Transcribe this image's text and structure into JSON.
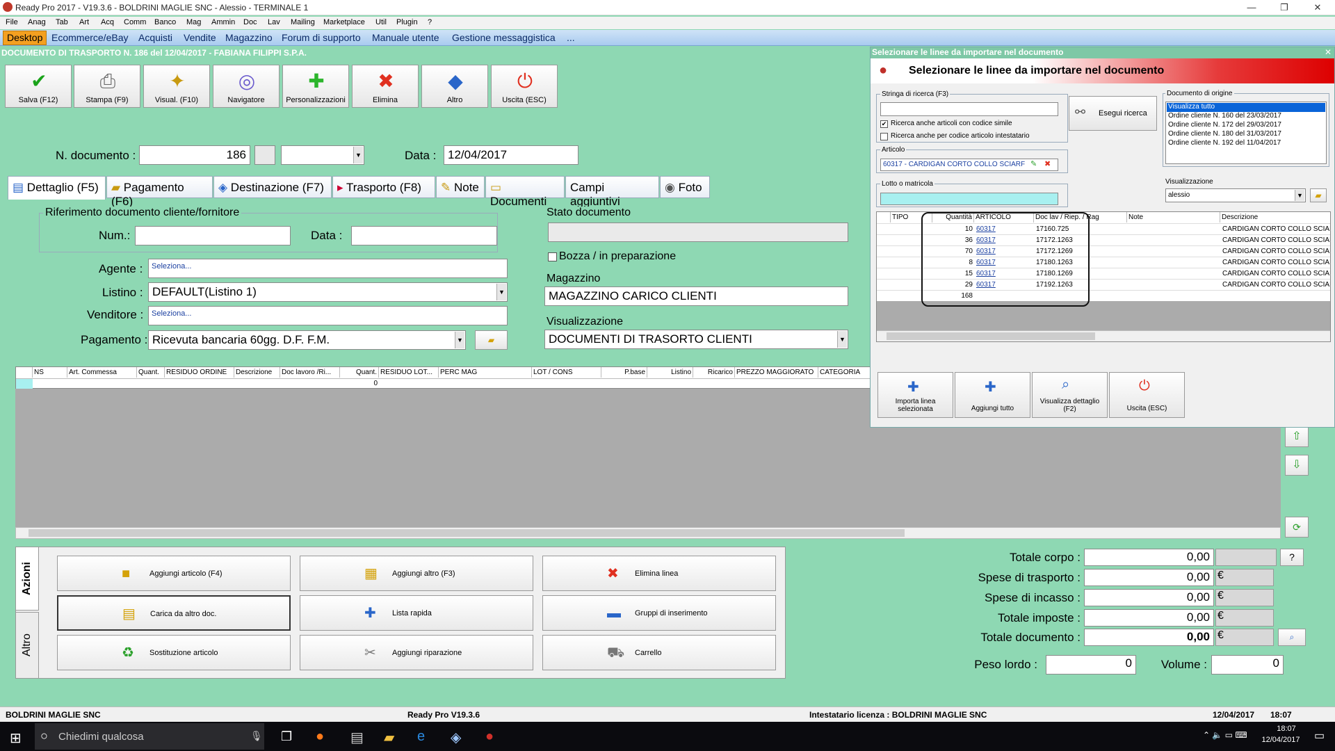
{
  "window": {
    "title": "Ready Pro 2017 - V19.3.6 - BOLDRINI MAGLIE SNC - Alessio - TERMINALE 1"
  },
  "menu": [
    "File",
    "Anag",
    "Tab",
    "Art",
    "Acq",
    "Comm",
    "Banco",
    "Mag",
    "Ammin",
    "Doc",
    "Lav",
    "Mailing",
    "Marketplace",
    "Util",
    "Plugin",
    "?"
  ],
  "tabs": [
    "Desktop",
    "Ecommerce/eBay",
    "Acquisti",
    "Vendite",
    "Magazzino",
    "Forum di supporto",
    "Manuale utente",
    "Gestione messaggistica",
    "..."
  ],
  "doc_title": "DOCUMENTO DI TRASPORTO N. 186 del 12/04/2017 - FABIANA FILIPPI S.P.A.",
  "toolbar": [
    {
      "label": "Salva (F12)",
      "icon": "check-icon"
    },
    {
      "label": "Stampa (F9)",
      "icon": "printer-icon"
    },
    {
      "label": "Visual. (F10)",
      "icon": "magic-wand-icon"
    },
    {
      "label": "Navigatore",
      "icon": "navigator-icon"
    },
    {
      "label": "Personalizzazioni",
      "icon": "puzzle-icon"
    },
    {
      "label": "Elimina",
      "icon": "delete-icon"
    },
    {
      "label": "Altro",
      "icon": "altro-icon"
    },
    {
      "label": "Uscita (ESC)",
      "icon": "exit-icon"
    }
  ],
  "header": {
    "num_label": "N. documento :",
    "num_value": "186",
    "data_label": "Data :",
    "data_value": "12/04/2017"
  },
  "detail_tabs": [
    "Dettaglio (F5)",
    "Pagamento (F6)",
    "Destinazione (F7)",
    "Trasporto (F8)",
    "Note",
    "Documenti",
    "Campi aggiuntivi",
    "Foto"
  ],
  "rif": {
    "title": "Riferimento documento cliente/fornitore",
    "num_label": "Num.:",
    "data_label": "Data :"
  },
  "form": {
    "agente_label": "Agente :",
    "agente_value": "Seleziona...",
    "listino_label": "Listino :",
    "listino_value": "DEFAULT(Listino 1)",
    "venditore_label": "Venditore :",
    "venditore_value": "Seleziona...",
    "pagamento_label": "Pagamento :",
    "pagamento_value": "Ricevuta bancaria 60gg. D.F. F.M."
  },
  "stato": {
    "title": "Stato documento",
    "bozza": "Bozza / in preparazione",
    "magazzino_title": "Magazzino",
    "magazzino_value": "MAGAZZINO CARICO CLIENTI",
    "visual_title": "Visualizzazione",
    "visual_value": "DOCUMENTI DI TRASORTO CLIENTI"
  },
  "grid": {
    "headers": [
      "NS",
      "Art. Commessa",
      "Quant.",
      "RESIDUO ORDINE",
      "Descrizione",
      "Doc lavoro /Ri...",
      "Quant.",
      "RESIDUO LOT...",
      "PERC MAG",
      "LOT / CONS",
      "P.base",
      "Listino",
      "Ricarico",
      "PREZZO MAGGIORATO",
      "CATEGORIA"
    ],
    "row_quant": "0"
  },
  "side_tabs": {
    "azioni": "Azioni",
    "altro": "Altro"
  },
  "actions": [
    {
      "label": "Aggiungi articolo (F4)",
      "icon": "add-article-icon"
    },
    {
      "label": "Aggiungi altro (F3)",
      "icon": "add-other-icon"
    },
    {
      "label": "Elimina linea",
      "icon": "delete-line-icon"
    },
    {
      "label": "Carica da altro doc.",
      "icon": "load-doc-icon"
    },
    {
      "label": "Lista rapida",
      "icon": "quick-list-icon"
    },
    {
      "label": "Gruppi di inserimento",
      "icon": "insert-groups-icon"
    },
    {
      "label": "Sostituzione articolo",
      "icon": "replace-article-icon"
    },
    {
      "label": "Aggiungi riparazione",
      "icon": "repair-icon"
    },
    {
      "label": "Carrello",
      "icon": "cart-icon"
    }
  ],
  "totals": {
    "corpo_label": "Totale corpo :",
    "corpo_value": "0,00",
    "trasporto_label": "Spese di trasporto :",
    "trasporto_value": "0,00",
    "incasso_label": "Spese di incasso :",
    "incasso_value": "0,00",
    "imposte_label": "Totale imposte :",
    "imposte_value": "0,00",
    "documento_label": "Totale documento :",
    "documento_value": "0,00",
    "currency": "€",
    "peso_label": "Peso lordo :",
    "peso_value": "0",
    "volume_label": "Volume :",
    "volume_value": "0",
    "help": "?"
  },
  "status": {
    "company": "BOLDRINI MAGLIE SNC",
    "version": "Ready Pro V19.3.6",
    "license": "Intestatario licenza : BOLDRINI MAGLIE SNC",
    "date": "12/04/2017",
    "time": "18:07"
  },
  "taskbar": {
    "search": "Chiedimi qualcosa",
    "time": "18:07",
    "date": "12/04/2017"
  },
  "dialog": {
    "window_title": "Selezionare le linee da importare nel documento",
    "header": "Selezionare le linee da importare nel documento",
    "search_label": "Stringa di ricerca (F3)",
    "search_btn": "Esegui ricerca",
    "chk1": "Ricerca anche articoli con codice simile",
    "chk2": "Ricerca anche per codice articolo intestatario",
    "articolo_label": "Articolo",
    "articolo_value": "60317 - CARDIGAN CORTO COLLO SCIARF",
    "lotto_label": "Lotto o matricola",
    "origin_label": "Documento di origine",
    "origins": [
      "Visualizza tutto",
      "Ordine cliente N. 160 del 23/03/2017",
      "Ordine cliente N. 172 del 29/03/2017",
      "Ordine cliente N. 180 del 31/03/2017",
      "Ordine cliente N. 192 del 11/04/2017"
    ],
    "visual_label": "Visualizzazione",
    "visual_value": "alessio",
    "grid_headers": [
      "TIPO",
      "Quantità",
      "ARTICOLO",
      "Doc lav / Riep. / Rag",
      "Note",
      "Descrizione"
    ],
    "rows": [
      {
        "qty": "10",
        "art": "60317",
        "doc": "17160.725",
        "desc": "CARDIGAN CORTO COLLO SCIARF"
      },
      {
        "qty": "36",
        "art": "60317",
        "doc": "17172.1263",
        "desc": "CARDIGAN CORTO COLLO SCIARF"
      },
      {
        "qty": "70",
        "art": "60317",
        "doc": "17172.1269",
        "desc": "CARDIGAN CORTO COLLO SCIARF"
      },
      {
        "qty": "8",
        "art": "60317",
        "doc": "17180.1263",
        "desc": "CARDIGAN CORTO COLLO SCIARF"
      },
      {
        "qty": "15",
        "art": "60317",
        "doc": "17180.1269",
        "desc": "CARDIGAN CORTO COLLO SCIARF"
      },
      {
        "qty": "29",
        "art": "60317",
        "doc": "17192.1263",
        "desc": "CARDIGAN CORTO COLLO SCIARF"
      }
    ],
    "total_qty": "168",
    "buttons": [
      {
        "label": "Importa linea selezionata",
        "icon": "import-line-icon"
      },
      {
        "label": "Aggiungi tutto",
        "icon": "add-all-icon"
      },
      {
        "label": "Visualizza dettaglio (F2)",
        "icon": "view-detail-icon"
      },
      {
        "label": "Uscita (ESC)",
        "icon": "exit-icon"
      }
    ]
  }
}
